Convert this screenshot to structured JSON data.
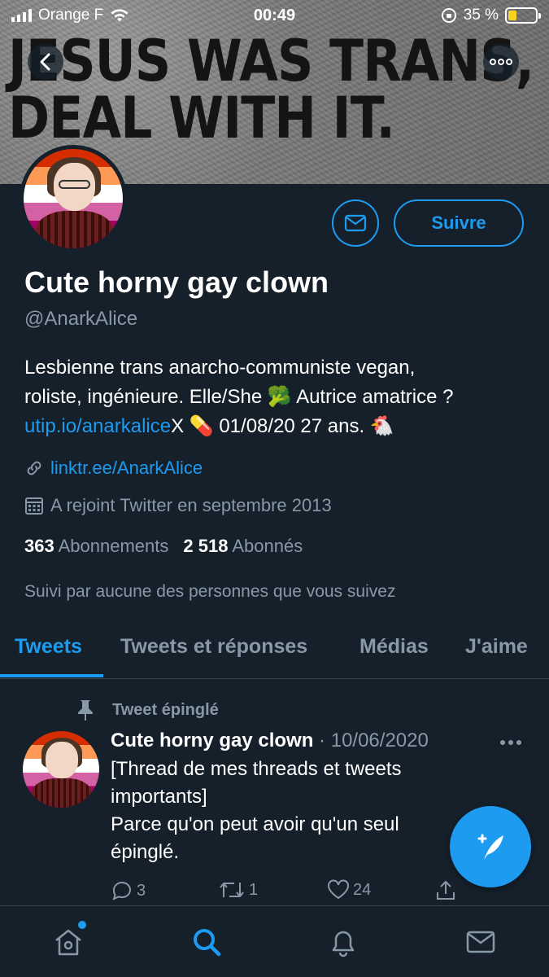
{
  "status_bar": {
    "carrier": "Orange F",
    "time": "00:49",
    "battery": "35 %",
    "battery_level": 0.35
  },
  "banner": {
    "line1": "JESUS WAS TRANS,",
    "line2": "DEAL WITH IT."
  },
  "icons": {
    "back": "chevron-left-icon",
    "more": "more-horizontal-icon",
    "message": "envelope-icon",
    "link": "link-icon",
    "calendar": "calendar-icon",
    "pin": "pin-icon",
    "reply": "comment-icon",
    "retweet": "retweet-icon",
    "like": "heart-icon",
    "share": "share-icon",
    "compose": "compose-icon",
    "home": "home-icon",
    "search": "search-icon",
    "notifications": "bell-icon",
    "messages": "envelope-icon"
  },
  "colors": {
    "background": "#15202b",
    "accent": "#1d9bf0",
    "muted": "#8899a6"
  },
  "profile": {
    "follow_label": "Suivre",
    "name": "Cute horny gay clown",
    "handle": "@AnarkAlice",
    "bio_line1": "Lesbienne trans anarcho-communiste vegan,",
    "bio_line2": "roliste, ingénieure. Elle/She 🥦 Autrice amatrice ?",
    "bio_link": "utip.io/anarkalice",
    "bio_line3_rest": "X 💊 01/08/20 27 ans. 🐔",
    "website": "linktr.ee/AnarkAlice",
    "joined": "A rejoint Twitter en septembre 2013",
    "following_count": "363",
    "following_label": "Abonnements",
    "followers_count": "2 518",
    "followers_label": "Abonnés",
    "followed_by": "Suivi par aucune des personnes que vous suivez"
  },
  "tabs": [
    {
      "label": "Tweets",
      "active": true
    },
    {
      "label": "Tweets et réponses",
      "active": false
    },
    {
      "label": "Médias",
      "active": false
    },
    {
      "label": "J'aime",
      "active": false
    }
  ],
  "pinned_tweet": {
    "pinned_label": "Tweet épinglé",
    "author": "Cute horny gay clown",
    "separator": "·",
    "date": "10/06/2020",
    "text_line1": "[Thread de mes threads et tweets",
    "text_line2": "importants]",
    "text_line3": "Parce qu'on peut avoir qu'un seul",
    "text_line4": "épinglé.",
    "replies": "3",
    "retweets": "1",
    "likes": "24"
  }
}
